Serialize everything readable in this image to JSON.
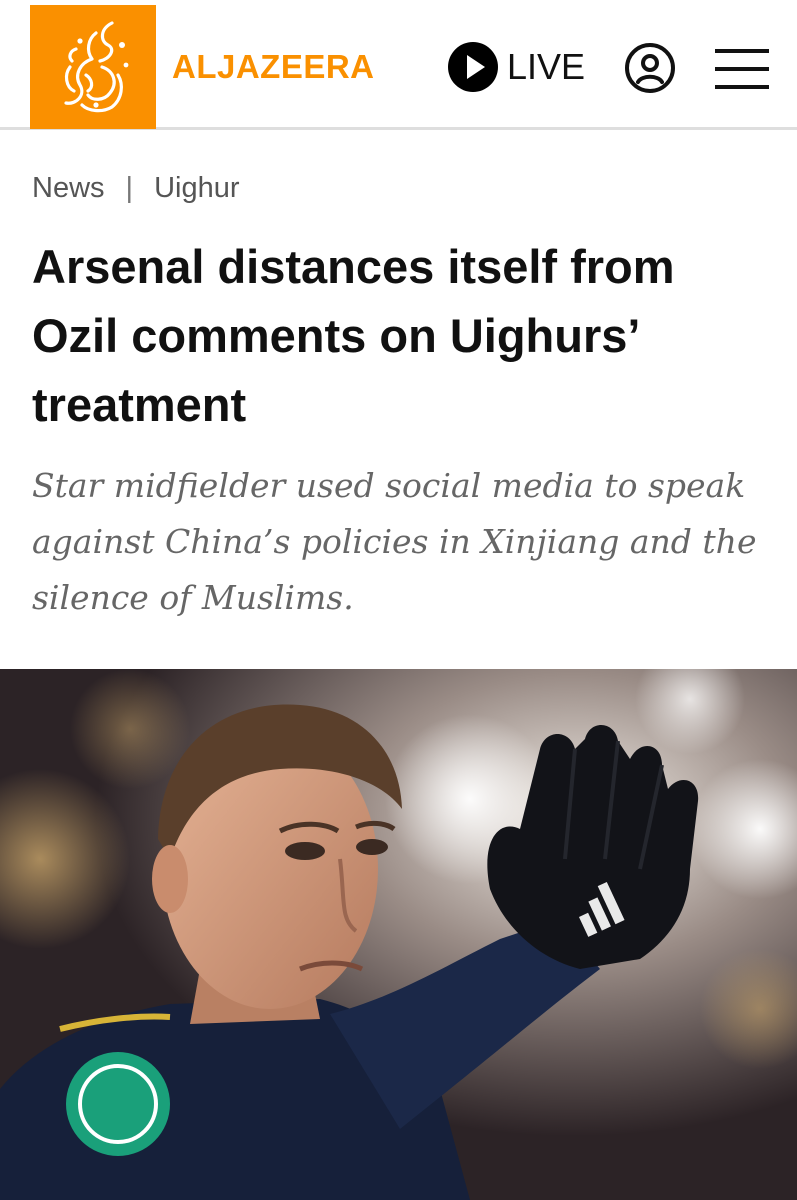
{
  "header": {
    "brand_name": "ALJAZEERA",
    "live_label": "LIVE",
    "brand_color": "#fa9000",
    "logo_icon": "aljazeera-calligraphy-logo",
    "play_icon": "play-circle-icon",
    "account_icon": "user-circle-icon",
    "menu_icon": "hamburger-menu-icon"
  },
  "breadcrumb": {
    "section": "News",
    "separator": "|",
    "topic": "Uighur"
  },
  "article": {
    "title": "Arsenal distances itself from Ozil comments on Uighurs’ treatment",
    "subtitle": "Star midfielder used social media to speak against China’s policies in Xinjiang and the silence of Muslims."
  },
  "photo": {
    "subject": "footballer-waving-gloved-hand"
  }
}
